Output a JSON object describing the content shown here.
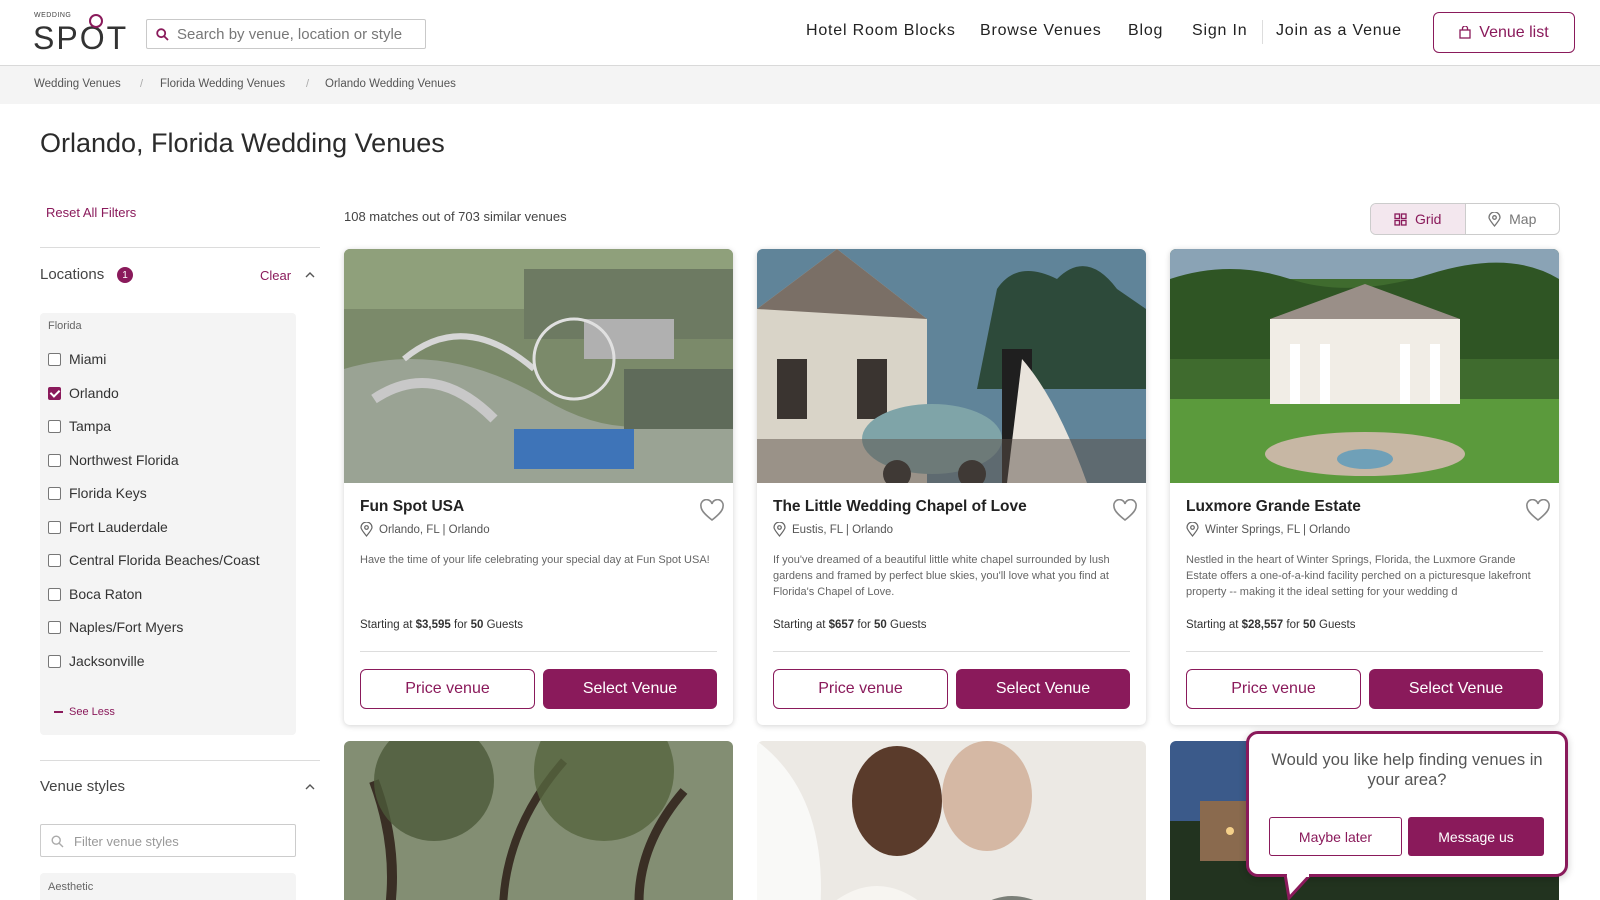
{
  "header": {
    "logo_small": "WEDDING",
    "logo_big": "SPOT",
    "search_placeholder": "Search by venue, location or style",
    "nav": [
      "Hotel Room Blocks",
      "Browse Venues",
      "Blog",
      "Sign In",
      "Join as a Venue"
    ],
    "venue_list_label": "Venue list"
  },
  "breadcrumb": [
    "Wedding Venues",
    "Florida Wedding Venues",
    "Orlando Wedding Venues"
  ],
  "page_title": "Orlando, Florida Wedding Venues",
  "filters": {
    "reset_label": "Reset All Filters",
    "locations_title": "Locations",
    "locations_count": "1",
    "clear_label": "Clear",
    "group_label": "Florida",
    "options": [
      {
        "label": "Miami",
        "checked": false
      },
      {
        "label": "Orlando",
        "checked": true
      },
      {
        "label": "Tampa",
        "checked": false
      },
      {
        "label": "Northwest Florida",
        "checked": false
      },
      {
        "label": "Florida Keys",
        "checked": false
      },
      {
        "label": "Fort Lauderdale",
        "checked": false
      },
      {
        "label": "Central Florida Beaches/Coast",
        "checked": false
      },
      {
        "label": "Boca Raton",
        "checked": false
      },
      {
        "label": "Naples/Fort Myers",
        "checked": false
      },
      {
        "label": "Jacksonville",
        "checked": false
      }
    ],
    "see_less": "See Less",
    "venue_styles_title": "Venue styles",
    "styles_placeholder": "Filter venue styles",
    "aesthetic_label": "Aesthetic"
  },
  "results": {
    "match_count": "108 matches out of 703 similar venues",
    "view_grid": "Grid",
    "view_map": "Map"
  },
  "venues": [
    {
      "name": "Fun Spot USA",
      "location": "Orlando, FL | Orlando",
      "description": "Have the time of your life celebrating your special day at Fun Spot USA!",
      "price_prefix": "Starting at ",
      "price": "$3,595",
      "price_mid": " for ",
      "guests": "50",
      "price_suffix": " Guests",
      "price_btn": "Price venue",
      "select_btn": "Select Venue"
    },
    {
      "name": "The Little Wedding Chapel of Love",
      "location": "Eustis, FL | Orlando",
      "description": "If you've dreamed of a beautiful little white chapel surrounded by lush gardens and framed by perfect blue skies, you'll love what you find at Florida's Chapel of Love.",
      "price_prefix": "Starting at ",
      "price": "$657",
      "price_mid": " for ",
      "guests": "50",
      "price_suffix": " Guests",
      "price_btn": "Price venue",
      "select_btn": "Select Venue"
    },
    {
      "name": "Luxmore Grande Estate",
      "location": "Winter Springs, FL | Orlando",
      "description": "Nestled in the heart of Winter Springs, Florida, the Luxmore Grande Estate offers a one-of-a-kind facility perched on a picturesque lakefront property -- making it the ideal setting for your wedding d",
      "price_prefix": "Starting at ",
      "price": "$28,557",
      "price_mid": " for ",
      "guests": "50",
      "price_suffix": " Guests",
      "price_btn": "Price venue",
      "select_btn": "Select Venue"
    }
  ],
  "popup": {
    "question": "Would you like help finding venues in your area?",
    "maybe_label": "Maybe later",
    "message_label": "Message us"
  },
  "colors": {
    "accent": "#8a1a5b",
    "breadcrumb_bg": "#f4f4f4",
    "panel_bg": "#f4f4f4"
  }
}
